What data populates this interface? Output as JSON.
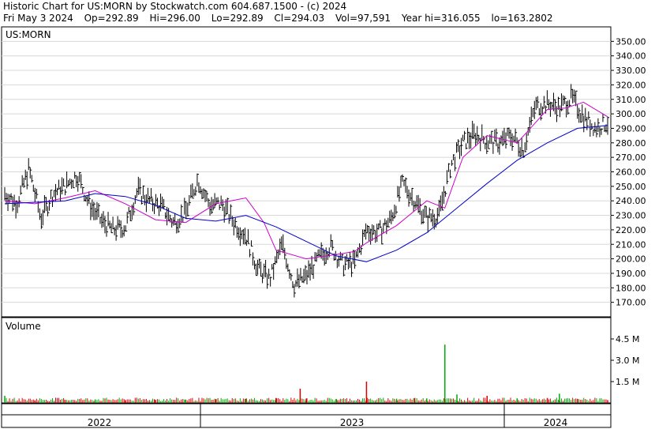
{
  "header": {
    "title": "Historic Chart for US:MORN by Stockwatch.com 604.687.1500 - (c) 2024",
    "quote": {
      "date": "Fri May  3 2024",
      "open": "Op=292.89",
      "high": "Hi=296.00",
      "low": "Lo=292.89",
      "close": "Cl=294.03",
      "volume": "Vol=97,591",
      "year_hi": "Year hi=316.055",
      "year_lo": "lo=163.2802"
    }
  },
  "chart_data": [
    {
      "type": "line",
      "panel_label": "US:MORN",
      "x_labels": [
        "2022",
        "2023",
        "2024"
      ],
      "x_range": [
        "2022-01",
        "2024-05-03"
      ],
      "ylim": [
        160,
        360
      ],
      "y_ticks": [
        "350.00",
        "340.00",
        "330.00",
        "320.00",
        "310.00",
        "300.00",
        "290.00",
        "280.00",
        "270.00",
        "260.00",
        "250.00",
        "240.00",
        "230.00",
        "220.00",
        "210.00",
        "200.00",
        "190.00",
        "180.00",
        "170.00"
      ],
      "y_tick_values": [
        350,
        340,
        330,
        320,
        310,
        300,
        290,
        280,
        270,
        260,
        250,
        240,
        230,
        220,
        210,
        200,
        190,
        180,
        170
      ],
      "grid": true,
      "colors": {
        "price": "#000000",
        "ma_short": "#cc00cc",
        "ma_long": "#0000cc"
      },
      "series": [
        {
          "key": "price",
          "style": "ohlc-bars",
          "x": [
            0,
            0.02,
            0.04,
            0.06,
            0.08,
            0.1,
            0.12,
            0.14,
            0.16,
            0.18,
            0.2,
            0.22,
            0.24,
            0.26,
            0.28,
            0.3,
            0.32,
            0.34,
            0.36,
            0.38,
            0.4,
            0.42,
            0.44,
            0.46,
            0.48,
            0.5,
            0.52,
            0.54,
            0.56,
            0.58,
            0.6,
            0.62,
            0.64,
            0.66,
            0.68,
            0.7,
            0.72,
            0.74,
            0.76,
            0.78,
            0.8,
            0.82,
            0.84,
            0.86,
            0.88,
            0.9,
            0.92,
            0.94,
            0.96,
            0.98,
            1.0
          ],
          "values": [
            245,
            238,
            262,
            228,
            245,
            250,
            258,
            238,
            226,
            220,
            222,
            247,
            240,
            236,
            225,
            232,
            255,
            237,
            238,
            225,
            216,
            193,
            186,
            210,
            182,
            188,
            200,
            209,
            196,
            197,
            220,
            218,
            227,
            252,
            240,
            228,
            230,
            265,
            280,
            286,
            281,
            280,
            285,
            276,
            305,
            307,
            304,
            311,
            298,
            290,
            294
          ]
        },
        {
          "key": "ma_short",
          "style": "line",
          "x": [
            0,
            0.05,
            0.1,
            0.15,
            0.2,
            0.25,
            0.3,
            0.35,
            0.4,
            0.43,
            0.45,
            0.5,
            0.55,
            0.58,
            0.6,
            0.65,
            0.7,
            0.73,
            0.76,
            0.8,
            0.85,
            0.9,
            0.93,
            0.96,
            1.0
          ],
          "values": [
            240,
            238,
            242,
            247,
            238,
            227,
            225,
            238,
            242,
            225,
            206,
            200,
            203,
            205,
            211,
            223,
            240,
            235,
            270,
            285,
            280,
            303,
            304,
            308,
            298
          ]
        },
        {
          "key": "ma_long",
          "style": "line",
          "x": [
            0,
            0.1,
            0.15,
            0.2,
            0.25,
            0.3,
            0.35,
            0.4,
            0.45,
            0.5,
            0.55,
            0.6,
            0.65,
            0.7,
            0.75,
            0.8,
            0.85,
            0.9,
            0.95,
            1.0
          ],
          "values": [
            238,
            240,
            245,
            243,
            237,
            228,
            226,
            230,
            222,
            212,
            202,
            198,
            206,
            218,
            235,
            252,
            268,
            280,
            290,
            292
          ]
        }
      ]
    },
    {
      "type": "bar",
      "panel_label": "Volume",
      "ylim": [
        0,
        6.0
      ],
      "y_ticks": [
        "4.5 M",
        "3.0 M",
        "1.5 M"
      ],
      "y_tick_values": [
        4.5,
        3.0,
        1.5
      ],
      "colors": {
        "up": "#00aa00",
        "down": "#dd0000"
      },
      "x": [
        0,
        0.05,
        0.1,
        0.15,
        0.2,
        0.25,
        0.3,
        0.35,
        0.4,
        0.45,
        0.49,
        0.5,
        0.55,
        0.6,
        0.65,
        0.68,
        0.7,
        0.73,
        0.75,
        0.8,
        0.85,
        0.9,
        0.92,
        0.95,
        1.0
      ],
      "values": [
        0.5,
        0.18,
        0.22,
        0.25,
        0.2,
        0.22,
        0.24,
        0.26,
        0.3,
        0.35,
        1.0,
        0.3,
        0.28,
        1.5,
        0.3,
        0.35,
        0.32,
        4.1,
        0.6,
        0.5,
        0.3,
        0.35,
        0.65,
        0.28,
        0.2
      ],
      "direction": [
        "up",
        "down",
        "down",
        "up",
        "down",
        "down",
        "up",
        "down",
        "up",
        "down",
        "down",
        "down",
        "up",
        "down",
        "up",
        "down",
        "up",
        "up",
        "up",
        "down",
        "up",
        "down",
        "up",
        "down",
        "down"
      ]
    }
  ]
}
